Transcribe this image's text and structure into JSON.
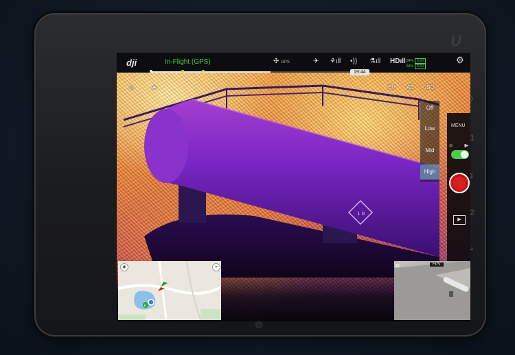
{
  "device": {
    "logo": "U",
    "side_buttons": [
      "⏻",
      "F1",
      "⇆",
      "F2",
      "↩"
    ]
  },
  "topbar": {
    "brand": "dji",
    "flight_status": "In-Flight (GPS)",
    "gps_label": "GPS",
    "hd_label": "HD",
    "time": "19:44",
    "battery": [
      "84%",
      "84%"
    ],
    "battery_volts": [
      "3.9V",
      "3.9V"
    ]
  },
  "overlay": {
    "exposure_label": "EV",
    "mode_label": "ISO",
    "lock_label": "AE"
  },
  "iso_panel": {
    "items": [
      "Off",
      "Low",
      "Mid",
      "High"
    ],
    "selected": "High"
  },
  "controls": {
    "menu_label": "MENU",
    "photo_label": "◎",
    "video_label": "▮▸",
    "toggle_on": true
  },
  "fpv": {
    "label": "FPV"
  },
  "colors": {
    "status_green": "#4ecb4e",
    "record_red": "#d62020",
    "iso_active": "#78aac8"
  }
}
